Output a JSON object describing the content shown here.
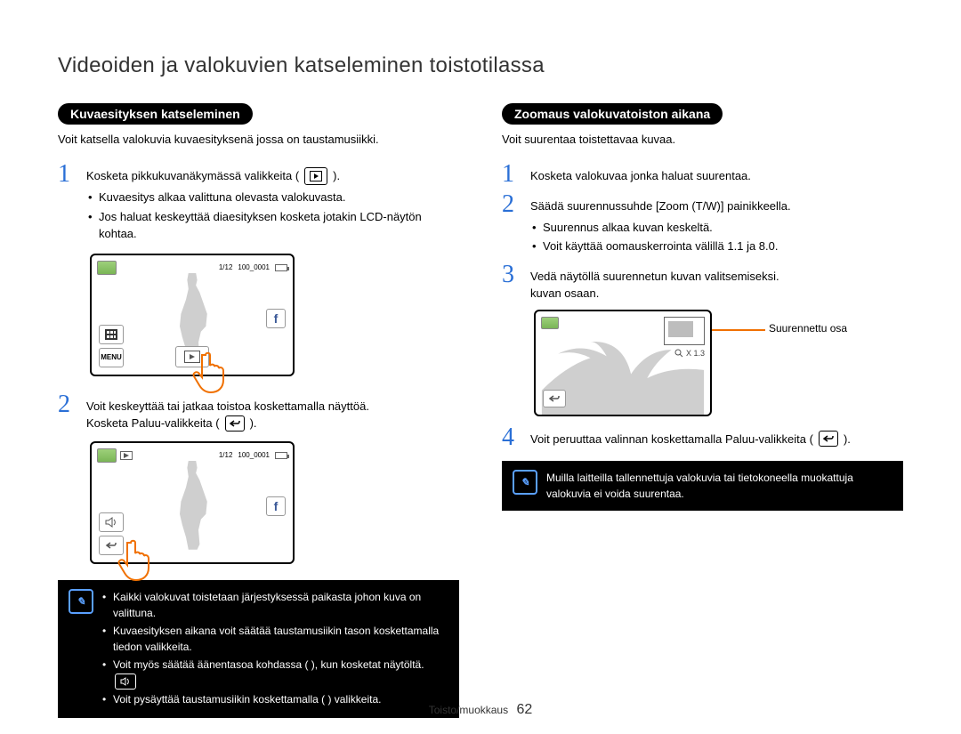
{
  "page_title": "Videoiden ja valokuvien katseleminen toistotilassa",
  "left": {
    "heading": "Kuvaesityksen katseleminen",
    "intro": "Voit katsella valokuvia kuvaesityksenä jossa on taustamusiikki.",
    "step1_text": "Kosketa pikkukuvanäkymässä valikkeita (",
    "step1_text_after": ").",
    "step1_bullets": [
      "Kuvaesitys alkaa valittuna olevasta valokuvasta.",
      "Jos haluat keskeyttää diaesityksen kosketa jotakin LCD-näytön kohtaa."
    ],
    "lcd1": {
      "counter": "1/12",
      "file": "100_0001",
      "menu": "MENU"
    },
    "step2_line1": "Voit keskeyttää tai jatkaa toistoa koskettamalla näyttöä.",
    "step2_line2_pre": "Kosketa Paluu-valikkeita (",
    "step2_line2_post": ").",
    "lcd2": {
      "counter": "1/12",
      "file": "100_0001"
    },
    "note": {
      "items": [
        "Kaikki valokuvat toistetaan järjestyksessä paikasta johon kuva on valittuna.",
        "Kuvaesityksen aikana voit säätää taustamusiikin tason koskettamalla tiedon valikkeita.",
        "Voit myös säätää äänentasoa kohdassa (      ), kun kosketat näytöltä.",
        "Voit pysäyttää taustamusiikin koskettamalla (      ) valikkeita."
      ]
    }
  },
  "right": {
    "heading": "Zoomaus valokuvatoiston aikana",
    "intro": "Voit suurentaa toistettavaa kuvaa.",
    "step1_text": "Kosketa valokuvaa jonka haluat suurentaa.",
    "step2_line1": "Säädä suurennussuhde [Zoom (T/W)] painikkeella.",
    "step2_bullets": [
      "Suurennus alkaa kuvan keskeltä.",
      "Voit käyttää oomauskerrointa välillä 1.1 ja 8.0."
    ],
    "step3_line1": "Vedä näytöllä suurennetun kuvan valitsemiseksi.",
    "step3_line2": "kuvan osaan.",
    "zoom_label": "X 1.3",
    "callout": "Suurennettu osa",
    "step4_pre": "Voit peruuttaa valinnan koskettamalla Paluu-valikkeita (",
    "step4_post": ").",
    "note": "Muilla laitteilla tallennettuja valokuvia tai tietokoneella muokattuja valokuvia ei voida suurentaa."
  },
  "footer": {
    "section": "Toisto/muokkaus",
    "page": "62"
  }
}
